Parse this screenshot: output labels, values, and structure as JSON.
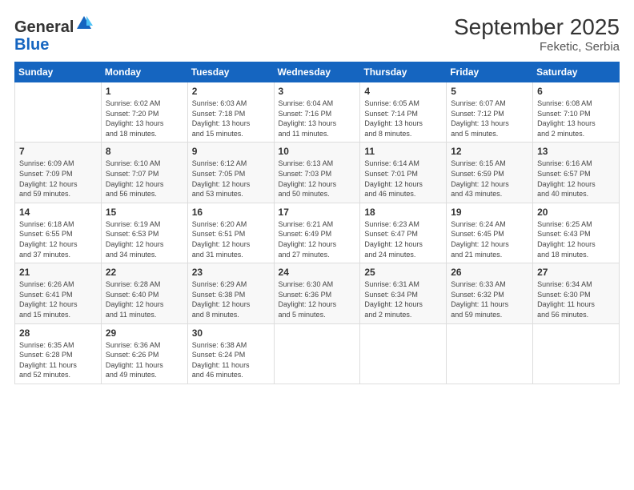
{
  "logo": {
    "general": "General",
    "blue": "Blue"
  },
  "title": "September 2025",
  "location": "Feketic, Serbia",
  "weekdays": [
    "Sunday",
    "Monday",
    "Tuesday",
    "Wednesday",
    "Thursday",
    "Friday",
    "Saturday"
  ],
  "weeks": [
    [
      {
        "day": "",
        "text": ""
      },
      {
        "day": "1",
        "text": "Sunrise: 6:02 AM\nSunset: 7:20 PM\nDaylight: 13 hours\nand 18 minutes."
      },
      {
        "day": "2",
        "text": "Sunrise: 6:03 AM\nSunset: 7:18 PM\nDaylight: 13 hours\nand 15 minutes."
      },
      {
        "day": "3",
        "text": "Sunrise: 6:04 AM\nSunset: 7:16 PM\nDaylight: 13 hours\nand 11 minutes."
      },
      {
        "day": "4",
        "text": "Sunrise: 6:05 AM\nSunset: 7:14 PM\nDaylight: 13 hours\nand 8 minutes."
      },
      {
        "day": "5",
        "text": "Sunrise: 6:07 AM\nSunset: 7:12 PM\nDaylight: 13 hours\nand 5 minutes."
      },
      {
        "day": "6",
        "text": "Sunrise: 6:08 AM\nSunset: 7:10 PM\nDaylight: 13 hours\nand 2 minutes."
      }
    ],
    [
      {
        "day": "7",
        "text": "Sunrise: 6:09 AM\nSunset: 7:09 PM\nDaylight: 12 hours\nand 59 minutes."
      },
      {
        "day": "8",
        "text": "Sunrise: 6:10 AM\nSunset: 7:07 PM\nDaylight: 12 hours\nand 56 minutes."
      },
      {
        "day": "9",
        "text": "Sunrise: 6:12 AM\nSunset: 7:05 PM\nDaylight: 12 hours\nand 53 minutes."
      },
      {
        "day": "10",
        "text": "Sunrise: 6:13 AM\nSunset: 7:03 PM\nDaylight: 12 hours\nand 50 minutes."
      },
      {
        "day": "11",
        "text": "Sunrise: 6:14 AM\nSunset: 7:01 PM\nDaylight: 12 hours\nand 46 minutes."
      },
      {
        "day": "12",
        "text": "Sunrise: 6:15 AM\nSunset: 6:59 PM\nDaylight: 12 hours\nand 43 minutes."
      },
      {
        "day": "13",
        "text": "Sunrise: 6:16 AM\nSunset: 6:57 PM\nDaylight: 12 hours\nand 40 minutes."
      }
    ],
    [
      {
        "day": "14",
        "text": "Sunrise: 6:18 AM\nSunset: 6:55 PM\nDaylight: 12 hours\nand 37 minutes."
      },
      {
        "day": "15",
        "text": "Sunrise: 6:19 AM\nSunset: 6:53 PM\nDaylight: 12 hours\nand 34 minutes."
      },
      {
        "day": "16",
        "text": "Sunrise: 6:20 AM\nSunset: 6:51 PM\nDaylight: 12 hours\nand 31 minutes."
      },
      {
        "day": "17",
        "text": "Sunrise: 6:21 AM\nSunset: 6:49 PM\nDaylight: 12 hours\nand 27 minutes."
      },
      {
        "day": "18",
        "text": "Sunrise: 6:23 AM\nSunset: 6:47 PM\nDaylight: 12 hours\nand 24 minutes."
      },
      {
        "day": "19",
        "text": "Sunrise: 6:24 AM\nSunset: 6:45 PM\nDaylight: 12 hours\nand 21 minutes."
      },
      {
        "day": "20",
        "text": "Sunrise: 6:25 AM\nSunset: 6:43 PM\nDaylight: 12 hours\nand 18 minutes."
      }
    ],
    [
      {
        "day": "21",
        "text": "Sunrise: 6:26 AM\nSunset: 6:41 PM\nDaylight: 12 hours\nand 15 minutes."
      },
      {
        "day": "22",
        "text": "Sunrise: 6:28 AM\nSunset: 6:40 PM\nDaylight: 12 hours\nand 11 minutes."
      },
      {
        "day": "23",
        "text": "Sunrise: 6:29 AM\nSunset: 6:38 PM\nDaylight: 12 hours\nand 8 minutes."
      },
      {
        "day": "24",
        "text": "Sunrise: 6:30 AM\nSunset: 6:36 PM\nDaylight: 12 hours\nand 5 minutes."
      },
      {
        "day": "25",
        "text": "Sunrise: 6:31 AM\nSunset: 6:34 PM\nDaylight: 12 hours\nand 2 minutes."
      },
      {
        "day": "26",
        "text": "Sunrise: 6:33 AM\nSunset: 6:32 PM\nDaylight: 11 hours\nand 59 minutes."
      },
      {
        "day": "27",
        "text": "Sunrise: 6:34 AM\nSunset: 6:30 PM\nDaylight: 11 hours\nand 56 minutes."
      }
    ],
    [
      {
        "day": "28",
        "text": "Sunrise: 6:35 AM\nSunset: 6:28 PM\nDaylight: 11 hours\nand 52 minutes."
      },
      {
        "day": "29",
        "text": "Sunrise: 6:36 AM\nSunset: 6:26 PM\nDaylight: 11 hours\nand 49 minutes."
      },
      {
        "day": "30",
        "text": "Sunrise: 6:38 AM\nSunset: 6:24 PM\nDaylight: 11 hours\nand 46 minutes."
      },
      {
        "day": "",
        "text": ""
      },
      {
        "day": "",
        "text": ""
      },
      {
        "day": "",
        "text": ""
      },
      {
        "day": "",
        "text": ""
      }
    ]
  ]
}
